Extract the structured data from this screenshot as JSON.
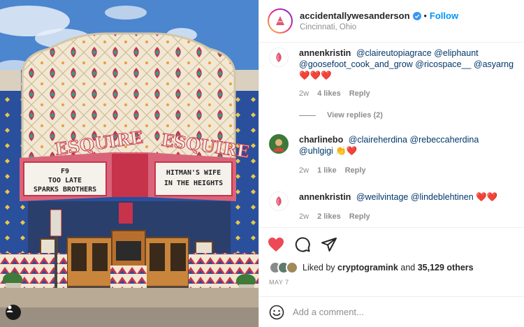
{
  "post": {
    "username": "accidentallywesanderson",
    "verified": true,
    "separator": "•",
    "follow_label": "Follow",
    "location": "Cincinnati, Ohio",
    "photo": {
      "marquee_left": [
        "F9",
        "TOO LATE",
        "SPARKS BROTHERS"
      ],
      "marquee_right": [
        "HITMAN'S WIFE",
        "IN THE HEIGHTS"
      ],
      "sign_left": "ESQUIRE",
      "sign_right": "ESQUIRE"
    }
  },
  "comments": [
    {
      "user": "annenkristin",
      "parts": [
        "@claireutopiagrace",
        "@eliphaunt",
        "@goosefoot_cook_and_grow",
        "@ricospace__",
        "@asyarng"
      ],
      "hearts": "❤️❤️❤️",
      "age": "2w",
      "likes": "4 likes",
      "reply": "Reply",
      "view_replies": "View replies (2)"
    },
    {
      "user": "charlinebo",
      "parts": [
        "@claireherdina",
        "@rebeccaherdina",
        "@uhlgigi"
      ],
      "hearts": "👏❤️",
      "age": "2w",
      "likes": "1 like",
      "reply": "Reply"
    },
    {
      "user": "annenkristin",
      "parts": [
        "@weilvintage",
        "@lindeblehtinen"
      ],
      "hearts": "❤️❤️",
      "age": "2w",
      "likes": "2 likes",
      "reply": "Reply"
    }
  ],
  "likes_line": {
    "prefix": "Liked by",
    "user": "cryptogramink",
    "conj": "and",
    "others": "35,129 others"
  },
  "date": "MAY 7",
  "add_comment": {
    "placeholder": "Add a comment..."
  },
  "colors": {
    "accent": "#0095f6",
    "heart": "#ed4956",
    "sky": "#4b86cf",
    "wall": "#2a4f9c",
    "facade_red": "#c7334b",
    "facade_cream": "#f1e7d3"
  },
  "icons": [
    "verified-icon",
    "heart-icon",
    "comment-icon",
    "share-icon",
    "emoji-icon",
    "tag-user-icon"
  ]
}
